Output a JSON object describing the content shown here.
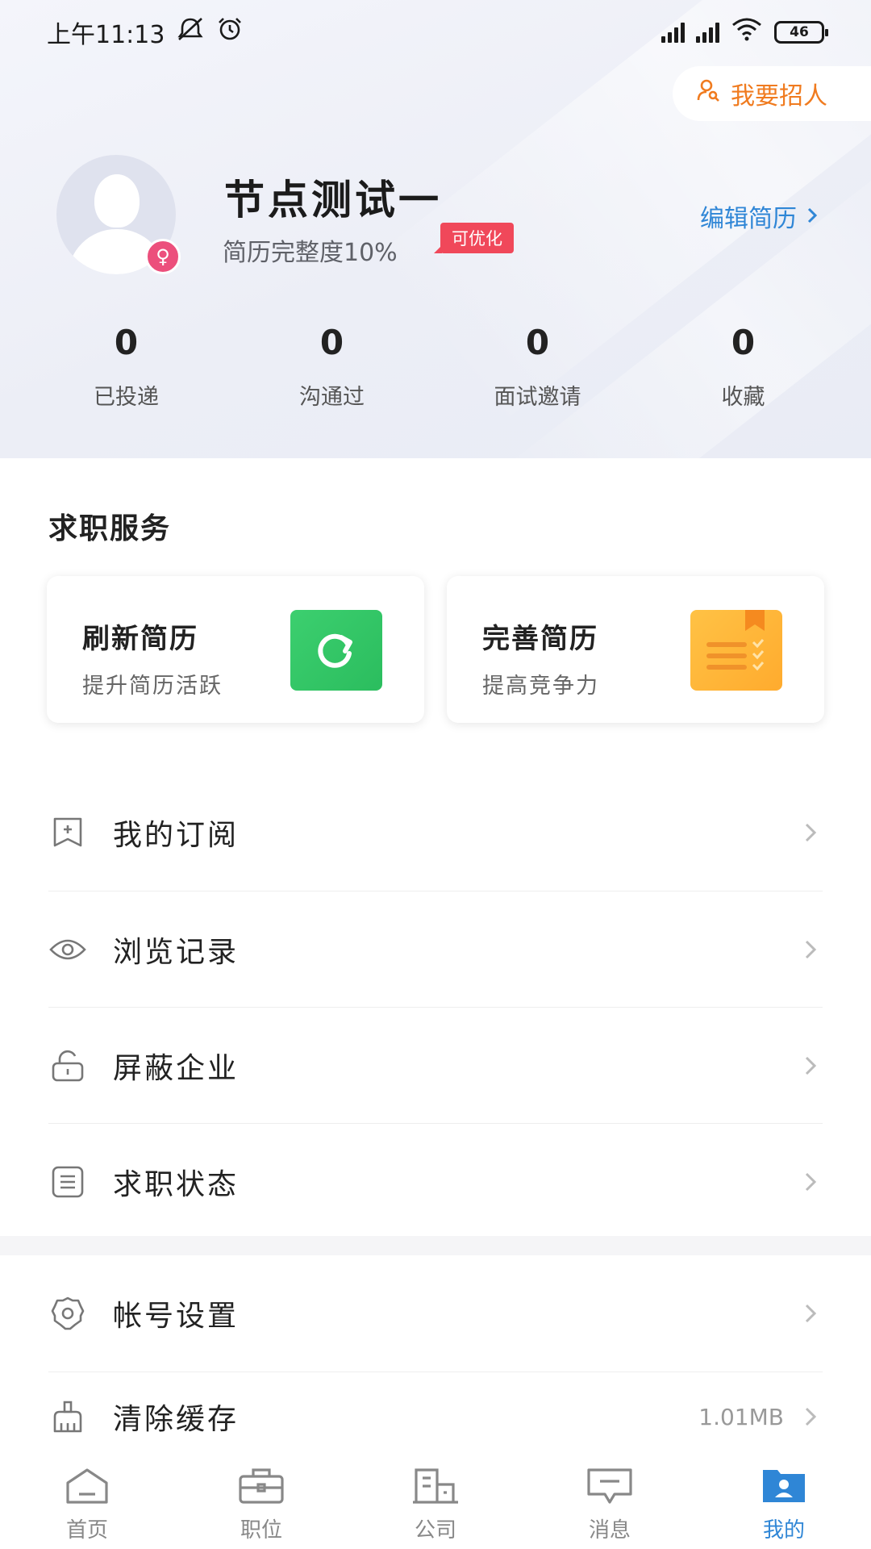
{
  "status_bar": {
    "time": "上午11:13",
    "battery": "46"
  },
  "header": {
    "recruit_label": "我要招人",
    "user_name": "节点测试一",
    "completeness": "简历完整度10%",
    "optimize_tag": "可优化",
    "edit_resume": "编辑简历",
    "stats": [
      {
        "value": "0",
        "label": "已投递"
      },
      {
        "value": "0",
        "label": "沟通过"
      },
      {
        "value": "0",
        "label": "面试邀请"
      },
      {
        "value": "0",
        "label": "收藏"
      }
    ]
  },
  "services": {
    "title": "求职服务",
    "cards": [
      {
        "title": "刷新简历",
        "subtitle": "提升简历活跃"
      },
      {
        "title": "完善简历",
        "subtitle": "提高竞争力"
      }
    ]
  },
  "menu": {
    "items": [
      {
        "label": "我的订阅",
        "icon": "bookmark-icon"
      },
      {
        "label": "浏览记录",
        "icon": "eye-icon"
      },
      {
        "label": "屏蔽企业",
        "icon": "unlock-icon"
      },
      {
        "label": "求职状态",
        "icon": "list-icon"
      },
      {
        "label": "帐号设置",
        "icon": "gear-icon"
      },
      {
        "label": "清除缓存",
        "icon": "broom-icon",
        "value": "1.01MB"
      }
    ]
  },
  "tabs": [
    {
      "label": "首页",
      "icon": "home-icon"
    },
    {
      "label": "职位",
      "icon": "briefcase-icon"
    },
    {
      "label": "公司",
      "icon": "building-icon"
    },
    {
      "label": "消息",
      "icon": "message-icon"
    },
    {
      "label": "我的",
      "icon": "profile-icon",
      "active": true
    }
  ],
  "colors": {
    "accent": "#2f86d6",
    "recruit": "#f07b1f",
    "tag": "#f0485a",
    "refresh_icon": "#2bbd5e",
    "book_icon": "#ffab2e"
  }
}
